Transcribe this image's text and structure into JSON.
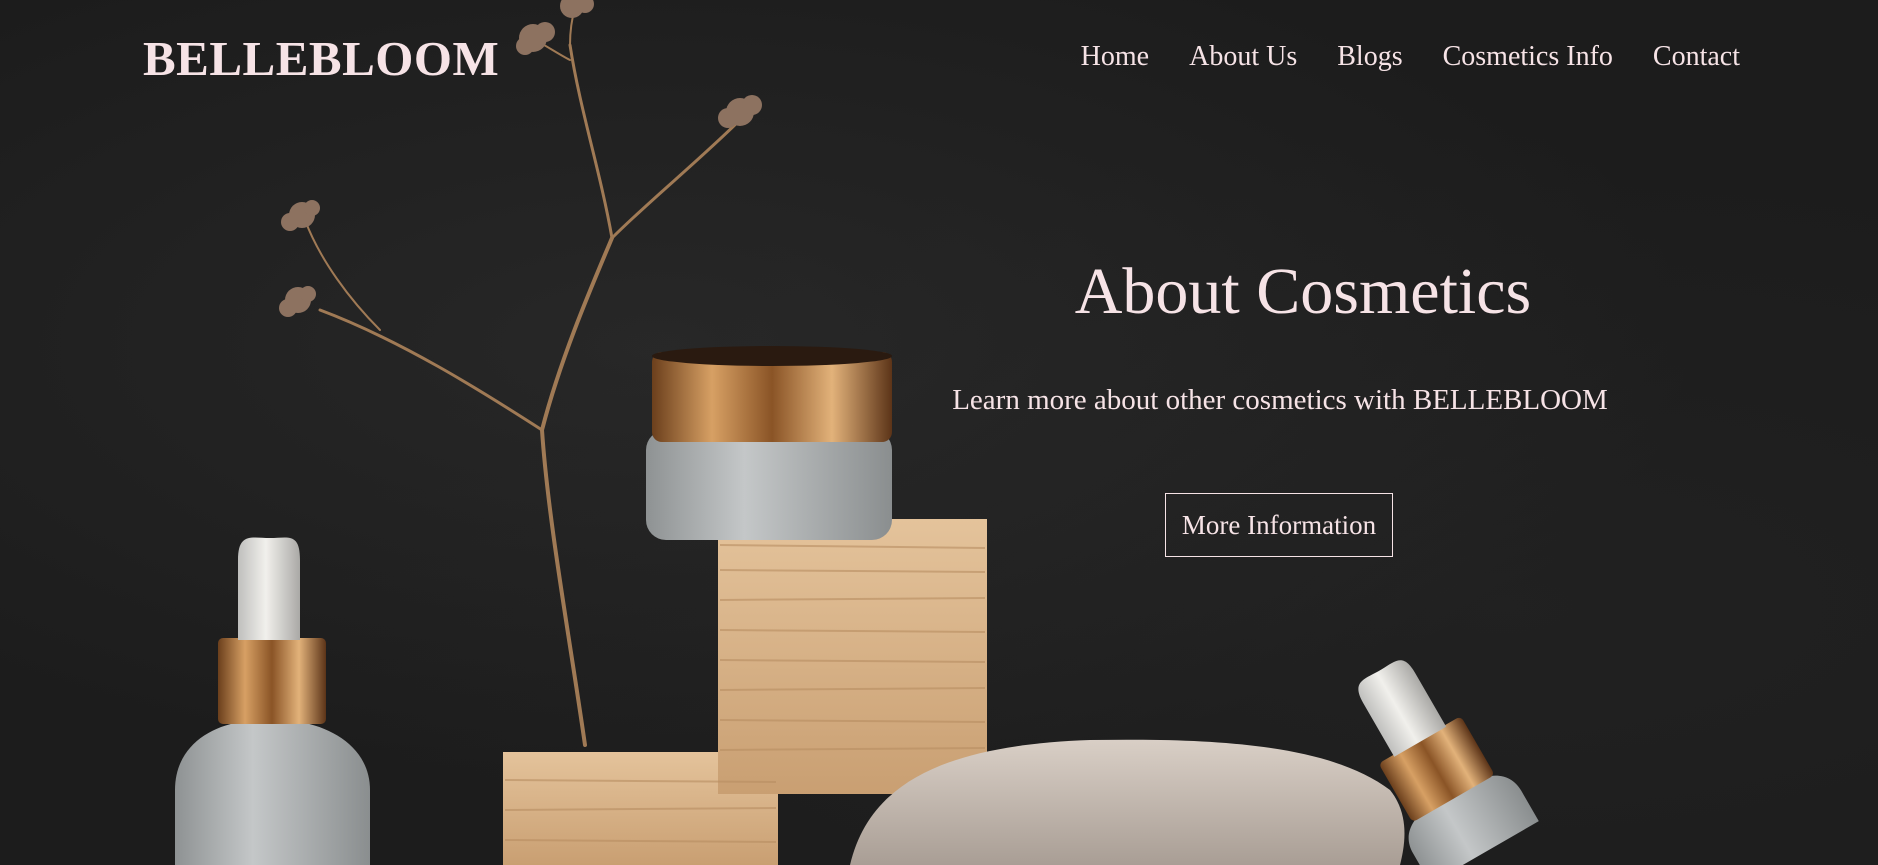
{
  "brand": {
    "name": "BELLEBLOOM"
  },
  "nav": {
    "items": [
      {
        "label": "Home"
      },
      {
        "label": "About Us"
      },
      {
        "label": "Blogs"
      },
      {
        "label": "Cosmetics Info"
      },
      {
        "label": "Contact"
      }
    ]
  },
  "hero": {
    "title": "About Cosmetics",
    "subtitle": "Learn more about other cosmetics with BELLEBLOOM",
    "button_label": "More Information"
  },
  "colors": {
    "background": "#1c1c1c",
    "text": "#f6e3e6",
    "gold": "#b87a3e",
    "wood": "#d9b48a",
    "frosted_glass": "#b9bcbd",
    "stone": "#c9bfb6"
  }
}
